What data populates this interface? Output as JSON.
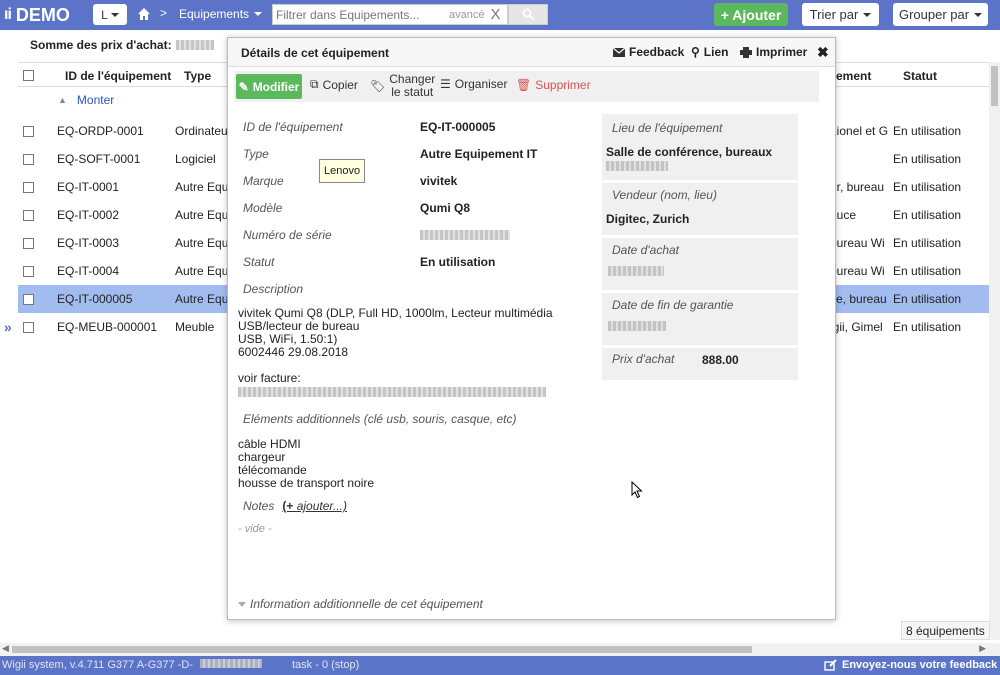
{
  "header": {
    "app_name": "DEMO",
    "user_button": "L",
    "breadcrumb": "Equipements",
    "search_placeholder": "Filtrer dans Equipements...",
    "search_advanced": "avancé",
    "search_clear": "X",
    "add_label": "+ Ajouter",
    "sort_label": "Trier par",
    "group_label": "Grouper par"
  },
  "list": {
    "sum_label": "Somme des prix d'achat:",
    "columns": {
      "id": "ID de l'équipement",
      "type": "Type",
      "extra": "ement",
      "status": "Statut"
    },
    "monter": "Monter",
    "rows": [
      {
        "id": "EQ-ORDP-0001",
        "type": "Ordinateur",
        "extra": "Lionel et G",
        "status": "En utilisation"
      },
      {
        "id": "EQ-SOFT-0001",
        "type": "Logiciel",
        "extra": "",
        "status": "En utilisation"
      },
      {
        "id": "EQ-IT-0001",
        "type": "Autre Equ",
        "extra": "ur, bureau",
        "status": "En utilisation"
      },
      {
        "id": "EQ-IT-0002",
        "type": "Autre Equ",
        "extra": "Luce",
        "status": "En utilisation"
      },
      {
        "id": "EQ-IT-0003",
        "type": "Autre Equ",
        "extra": "bureau Wi",
        "status": "En utilisation"
      },
      {
        "id": "EQ-IT-0004",
        "type": "Autre Equ",
        "extra": "bureau Wi",
        "status": "En utilisation"
      },
      {
        "id": "EQ-IT-000005",
        "type": "Autre Equ",
        "extra": "ce, bureau",
        "status": "En utilisation"
      },
      {
        "id": "EQ-MEUB-000001",
        "type": "Meuble",
        "extra": "igii, Gimel",
        "status": "En utilisation"
      }
    ],
    "count": "8 équipements"
  },
  "panel": {
    "title": "Détails de cet équipement",
    "feedback": "Feedback",
    "link": "Lien",
    "print": "Imprimer",
    "close": "✖",
    "toolbar": {
      "modify": "Modifier",
      "copy": "Copier",
      "change_status_1": "Changer",
      "change_status_2": "le statut",
      "organize": "Organiser",
      "delete": "Supprimer"
    },
    "fields": {
      "id_label": "ID de l'équipement",
      "id_value": "EQ-IT-000005",
      "type_label": "Type",
      "type_value": "Autre Equipement IT",
      "brand_label": "Marque",
      "brand_value": "vivitek",
      "model_label": "Modèle",
      "model_value": "Qumi Q8",
      "serial_label": "Numéro de série",
      "status_label": "Statut",
      "status_value": "En utilisation",
      "desc_label": "Description"
    },
    "description": {
      "line1": "vivitek Qumi Q8 (DLP, Full HD, 1000lm, Lecteur multimédia",
      "line2": "USB/lecteur de bureau",
      "line3": "USB, WiFi, 1.50:1)",
      "line4": "6002446 29.08.2018",
      "invoice": "voir facture:",
      "extras_label": "Eléments additionnels (clé usb, souris, casque, etc)",
      "extra1": "câble HDMI",
      "extra2": "chargeur",
      "extra3": "télécomande",
      "extra4": "housse de transport noire"
    },
    "tooltip": "Lenovo",
    "right": {
      "location_label": "Lieu de l'équipement",
      "location_value": "Salle de conférence, bureaux",
      "vendor_label": "Vendeur (nom, lieu)",
      "vendor_value": "Digitec, Zurich",
      "purchase_date_label": "Date d'achat",
      "warranty_label": "Date de fin de garantie",
      "price_label": "Prix d'achat",
      "price_value": "888.00"
    },
    "notes_label": "Notes",
    "notes_add": "ajouter...)",
    "notes_add_prefix": "(+ ",
    "empty": "- vide -",
    "info": "Information additionnelle de cet équipement"
  },
  "footer": {
    "version": "Wigii system, v.4.711 G377 A-G377 -D-",
    "task": "task -  0  (stop)",
    "feedback": "Envoyez-nous votre feedback"
  },
  "colors": {
    "brand": "#5b74c8",
    "add": "#5cb85c",
    "selected_row": "#a3bcf0",
    "delete": "#d9534f"
  }
}
